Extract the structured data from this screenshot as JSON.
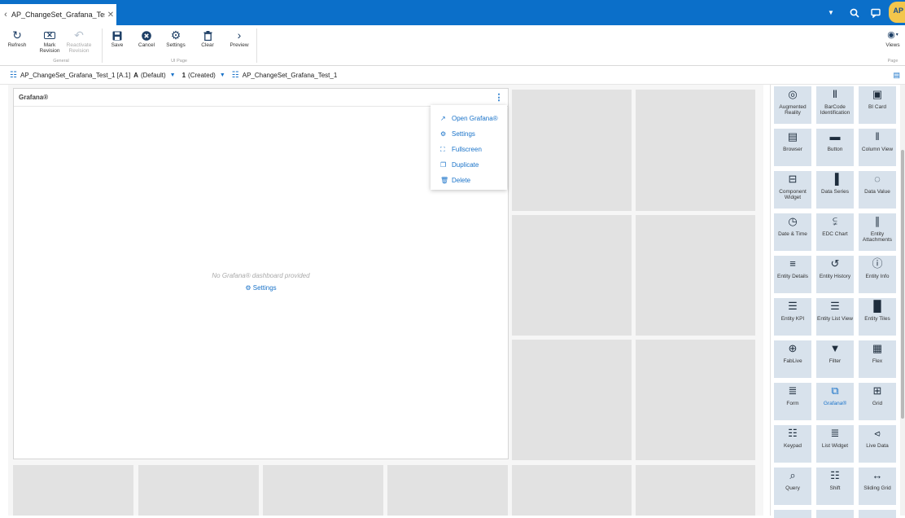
{
  "tab": {
    "title": "AP_ChangeSet_Grafana_Test"
  },
  "user": {
    "initials": "AP"
  },
  "ribbon": {
    "refresh": "Refresh",
    "mark_revision": "Mark Revision",
    "reactivate_revision": "Reactivate Revision",
    "group_general": "General",
    "save": "Save",
    "cancel": "Cancel",
    "settings": "Settings",
    "clear": "Clear",
    "preview": "Preview",
    "group_ui_page": "UI Page",
    "views": "Views",
    "group_page": "Page"
  },
  "breadcrumb": {
    "entity": "AP_ChangeSet_Grafana_Test_1 [A.1]",
    "version_letter": "A",
    "version_state": "(Default)",
    "revision_number": "1",
    "revision_state": "(Created)",
    "changeset": "AP_ChangeSet_Grafana_Test_1"
  },
  "widget": {
    "title": "Grafana®",
    "empty_message": "No Grafana® dashboard provided",
    "settings_link": "Settings"
  },
  "context_menu": {
    "items": [
      "Open Grafana®",
      "Settings",
      "Fullscreen",
      "Duplicate",
      "Delete"
    ]
  },
  "palette": {
    "tiles": [
      {
        "label": "Augmented Reality",
        "icon": "ar-icon"
      },
      {
        "label": "BarCode Identification",
        "icon": "barcode-icon"
      },
      {
        "label": "BI Card",
        "icon": "bi-card-icon"
      },
      {
        "label": "Browser",
        "icon": "browser-icon"
      },
      {
        "label": "Button",
        "icon": "button-icon"
      },
      {
        "label": "Column View",
        "icon": "column-view-icon"
      },
      {
        "label": "Component Widget",
        "icon": "component-widget-icon"
      },
      {
        "label": "Data Series",
        "icon": "data-series-icon"
      },
      {
        "label": "Data Value",
        "icon": "data-value-icon"
      },
      {
        "label": "Date & Time",
        "icon": "clock-icon"
      },
      {
        "label": "EDC Chart",
        "icon": "chart-icon"
      },
      {
        "label": "Entity Attachments",
        "icon": "paperclip-icon"
      },
      {
        "label": "Entity Details",
        "icon": "details-icon"
      },
      {
        "label": "Entity History",
        "icon": "history-icon"
      },
      {
        "label": "Entity Info",
        "icon": "info-icon"
      },
      {
        "label": "Entity KPI",
        "icon": "kpi-icon"
      },
      {
        "label": "Entity List View",
        "icon": "list-icon"
      },
      {
        "label": "Entity Tiles",
        "icon": "tiles-icon"
      },
      {
        "label": "FabLive",
        "icon": "fablive-icon"
      },
      {
        "label": "Filter",
        "icon": "filter-icon"
      },
      {
        "label": "Flex",
        "icon": "flex-icon"
      },
      {
        "label": "Form",
        "icon": "form-icon"
      },
      {
        "label": "Grafana®",
        "icon": "grafana-icon"
      },
      {
        "label": "Grid",
        "icon": "grid-icon"
      },
      {
        "label": "Keypad",
        "icon": "keypad-icon"
      },
      {
        "label": "List Widget",
        "icon": "list-widget-icon"
      },
      {
        "label": "Live Data",
        "icon": "live-data-icon"
      },
      {
        "label": "Query",
        "icon": "query-icon"
      },
      {
        "label": "Shift",
        "icon": "shift-icon"
      },
      {
        "label": "Sliding Grid",
        "icon": "sliding-grid-icon"
      }
    ]
  },
  "colors": {
    "accent": "#1a73c9",
    "topbar": "#0b6fc9",
    "tile": "#d8e2ec"
  }
}
